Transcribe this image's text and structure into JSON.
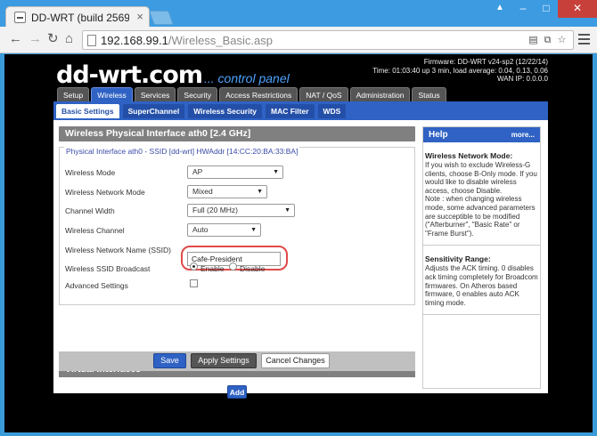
{
  "browser": {
    "tab_title": "DD-WRT (build 2569",
    "url_host": "192.168.99.1",
    "url_path": "/Wireless_Basic.asp"
  },
  "header": {
    "logo": "dd-wrt.com",
    "logo_sub": "... control panel",
    "firmware": "Firmware: DD-WRT v24-sp2 (12/22/14)",
    "time": "Time: 01:03:40 up 3 min, load average: 0.04, 0.13, 0.06",
    "wan_ip": "WAN IP: 0.0.0.0"
  },
  "main_tabs": [
    "Setup",
    "Wireless",
    "Services",
    "Security",
    "Access Restrictions",
    "NAT / QoS",
    "Administration",
    "Status"
  ],
  "sub_tabs": [
    "Basic Settings",
    "SuperChannel",
    "Wireless Security",
    "MAC Filter",
    "WDS"
  ],
  "section": {
    "title": "Wireless Physical Interface ath0 [2.4 GHz]",
    "legend": "Physical Interface ath0 - SSID [dd-wrt] HWAddr [14:CC:20:BA:33:BA]",
    "fields": {
      "mode_label": "Wireless Mode",
      "mode_value": "AP",
      "netmode_label": "Wireless Network Mode",
      "netmode_value": "Mixed",
      "width_label": "Channel Width",
      "width_value": "Full (20 MHz)",
      "channel_label": "Wireless Channel",
      "channel_value": "Auto",
      "ssid_label": "Wireless Network Name (SSID)",
      "ssid_value": "Cafe-President",
      "broadcast_label": "Wireless SSID Broadcast",
      "enable_label": "Enable",
      "disable_label": "Disable",
      "advanced_label": "Advanced Settings"
    }
  },
  "virtual": {
    "title": "Virtual Interfaces",
    "add_label": "Add"
  },
  "help": {
    "title": "Help",
    "more": "more...",
    "h1": "Wireless Network Mode:",
    "p1": "If you wish to exclude Wireless-G clients, choose B-Only mode. If you would like to disable wireless access, choose Disable.",
    "p1b": "Note : when changing wireless mode, some advanced parameters are succeptible to be modified (\"Afterburner\", \"Basic Rate\" or \"Frame Burst\").",
    "h2": "Sensitivity Range:",
    "p2": "Adjusts the ACK timing. 0 disables ack timing completely for Broadcom firmwares. On Atheros based firmware, 0 enables auto ACK timing mode."
  },
  "buttons": {
    "save": "Save",
    "apply": "Apply Settings",
    "cancel": "Cancel Changes"
  },
  "colors": {
    "accent": "#2f62c4",
    "highlight": "#e04a4a",
    "section_gray": "#808080"
  }
}
